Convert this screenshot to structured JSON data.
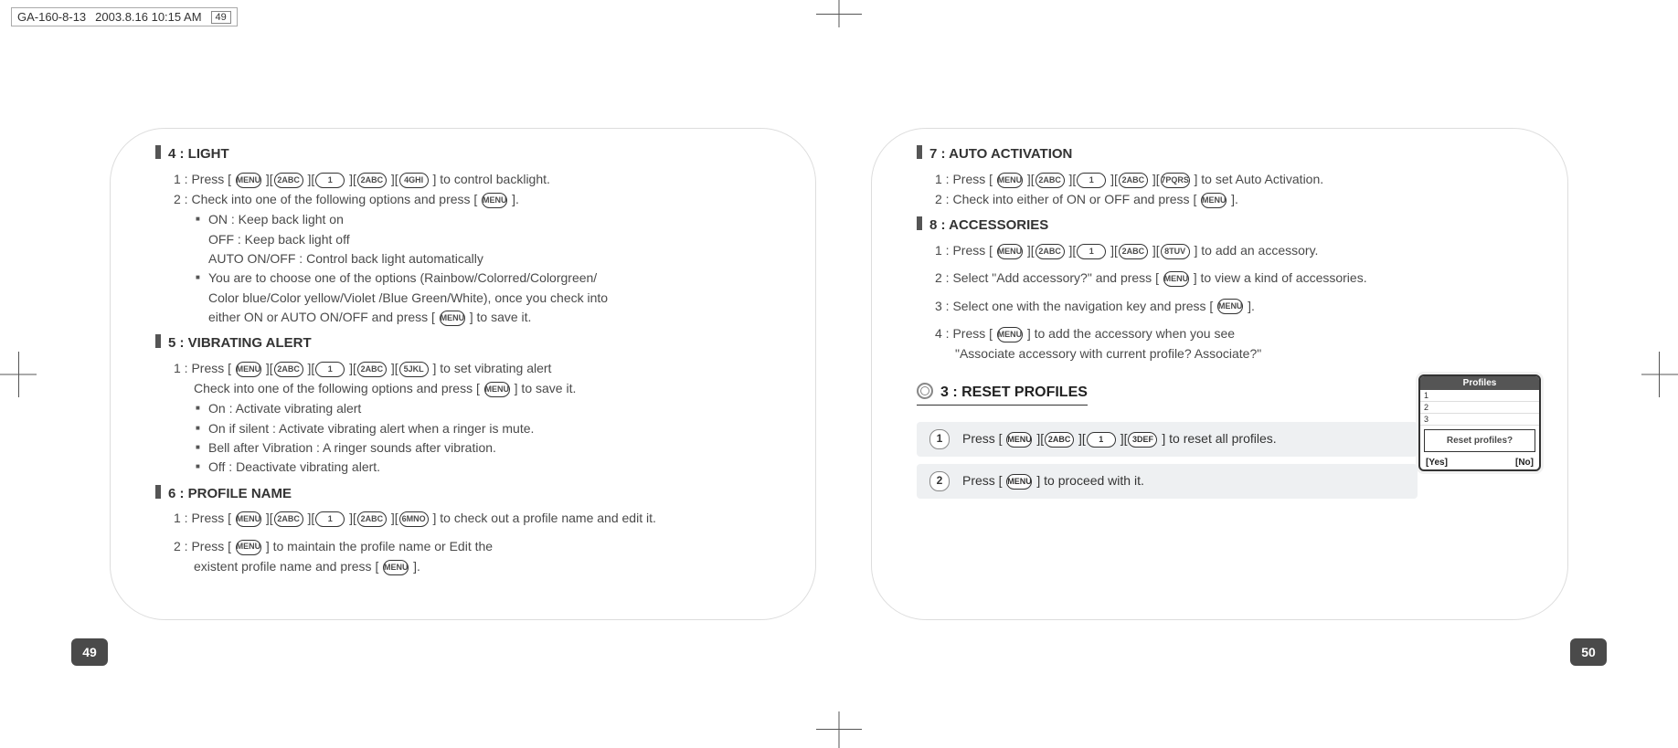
{
  "print_header": {
    "file": "GA-160-8-13",
    "timestamp": "2003.8.16 10:15 AM",
    "page_marker": "49"
  },
  "left": {
    "sections": {
      "light": {
        "title": "4 : LIGHT",
        "step1_prefix": "1 : Press [",
        "step1_suffix": "] to control backlight.",
        "step2_prefix": "2 : Check into one of the following options and press [",
        "step2_suffix": "].",
        "opt_on": "ON : Keep back light on",
        "opt_off": "OFF : Keep back light off",
        "opt_auto": "AUTO ON/OFF : Control back light automatically",
        "note_a": "You are to choose one of the options (Rainbow/Colorred/Colorgreen/",
        "note_b": "Color blue/Color yellow/Violet /Blue Green/White), once you check into",
        "note_c_prefix": "either ON or AUTO ON/OFF and press [",
        "note_c_suffix": "] to save it."
      },
      "vibrating": {
        "title": "5 : VIBRATING ALERT",
        "step1_prefix": "1 : Press [",
        "step1_suffix": "] to set vibrating alert",
        "step1b_prefix": "Check into one of the following options and press [",
        "step1b_suffix": "] to save it.",
        "opt_on": "On : Activate vibrating alert",
        "opt_silent": "On if silent : Activate vibrating alert when a ringer is mute.",
        "opt_bell": "Bell after Vibration : A ringer sounds after vibration.",
        "opt_off": "Off : Deactivate vibrating alert."
      },
      "profile": {
        "title": "6 : PROFILE NAME",
        "step1_prefix": "1 : Press [",
        "step1_suffix": "] to check out a profile name and edit it.",
        "step2_prefix": "2 : Press [",
        "step2_mid": "] to maintain the profile name or Edit the",
        "step2b_prefix": "existent profile name and press [",
        "step2b_suffix": "]."
      }
    },
    "page_number": "49"
  },
  "right": {
    "sections": {
      "auto": {
        "title": "7 : AUTO ACTIVATION",
        "step1_prefix": "1 : Press [",
        "step1_suffix": "] to set Auto Activation.",
        "step2_prefix": "2 : Check into either of ON or OFF and press [",
        "step2_suffix": "]."
      },
      "accessories": {
        "title": "8 : ACCESSORIES",
        "step1_prefix": "1 : Press [",
        "step1_suffix": "] to add an accessory.",
        "step2_prefix": "2 : Select \"Add accessory?\" and press [",
        "step2_suffix": "] to view a kind of accessories.",
        "step3_prefix": "3 : Select one with the navigation key and press [",
        "step3_suffix": "].",
        "step4_prefix": "4 : Press [",
        "step4_mid": "] to add the accessory when you see",
        "step4b": "\"Associate accessory with current profile? Associate?\""
      },
      "reset": {
        "title": "3 : RESET PROFILES",
        "step1_prefix": "Press [",
        "step1_suffix": "] to reset all profiles.",
        "step2_prefix": "Press [",
        "step2_suffix": "] to proceed with it."
      }
    },
    "phone": {
      "title": "Profiles",
      "row1": "1",
      "row2": "2",
      "row3": "3",
      "popup": "Reset profiles?",
      "soft_left": "[Yes]",
      "soft_right": "[No]"
    },
    "page_number": "50"
  },
  "keys": {
    "menu": "MENU",
    "k1": "1",
    "k2": "2ABC",
    "k3": "3DEF",
    "k4": "4GHI",
    "k5": "5JKL",
    "k6": "6MNO",
    "k7": "7PQRS",
    "k8": "8TUV"
  }
}
